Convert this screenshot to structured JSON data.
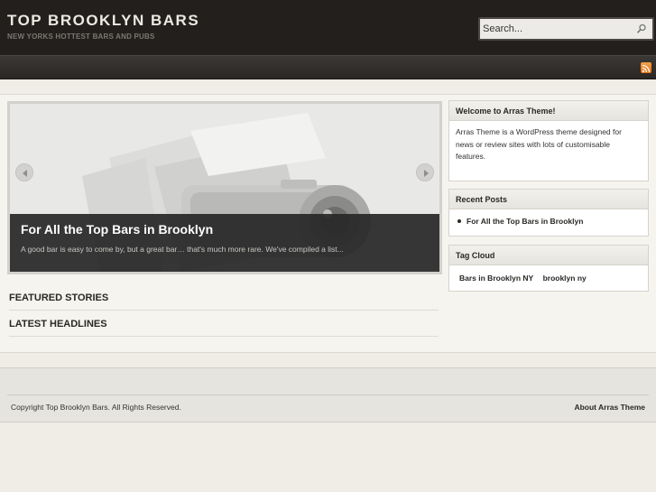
{
  "header": {
    "site_title": "TOP BROOKLYN BARS",
    "tagline": "NEW YORKS HOTTEST BARS AND PUBS",
    "search": {
      "placeholder": "Search..."
    }
  },
  "nav": {
    "rss_icon": "rss-feed-icon"
  },
  "slider": {
    "slide_title": "For All the Top Bars in Brooklyn",
    "slide_excerpt": "A good bar is easy to come by, but a great bar… that's much more rare. We've compiled a list...",
    "prev_icon": "chevron-left-icon",
    "next_icon": "chevron-right-icon"
  },
  "sections": {
    "featured": "FEATURED STORIES",
    "latest": "LATEST HEADLINES"
  },
  "sidebar": {
    "welcome": {
      "title": "Welcome to Arras Theme!",
      "body": "Arras Theme is a WordPress theme designed for news or review sites with lots of customisable features."
    },
    "recent_posts": {
      "title": "Recent Posts",
      "items": [
        "For All the Top Bars in Brooklyn"
      ]
    },
    "tag_cloud": {
      "title": "Tag Cloud",
      "tags": [
        "Bars in Brooklyn NY",
        "brooklyn ny"
      ]
    }
  },
  "footer": {
    "copyright": "Copyright Top Brooklyn Bars. All Rights Reserved.",
    "about_link": "About Arras Theme"
  },
  "colors": {
    "header_bg": "#221f1d",
    "page_bg": "#efede6",
    "caption_bg": "#282828",
    "rss_orange": "#e8801e"
  }
}
